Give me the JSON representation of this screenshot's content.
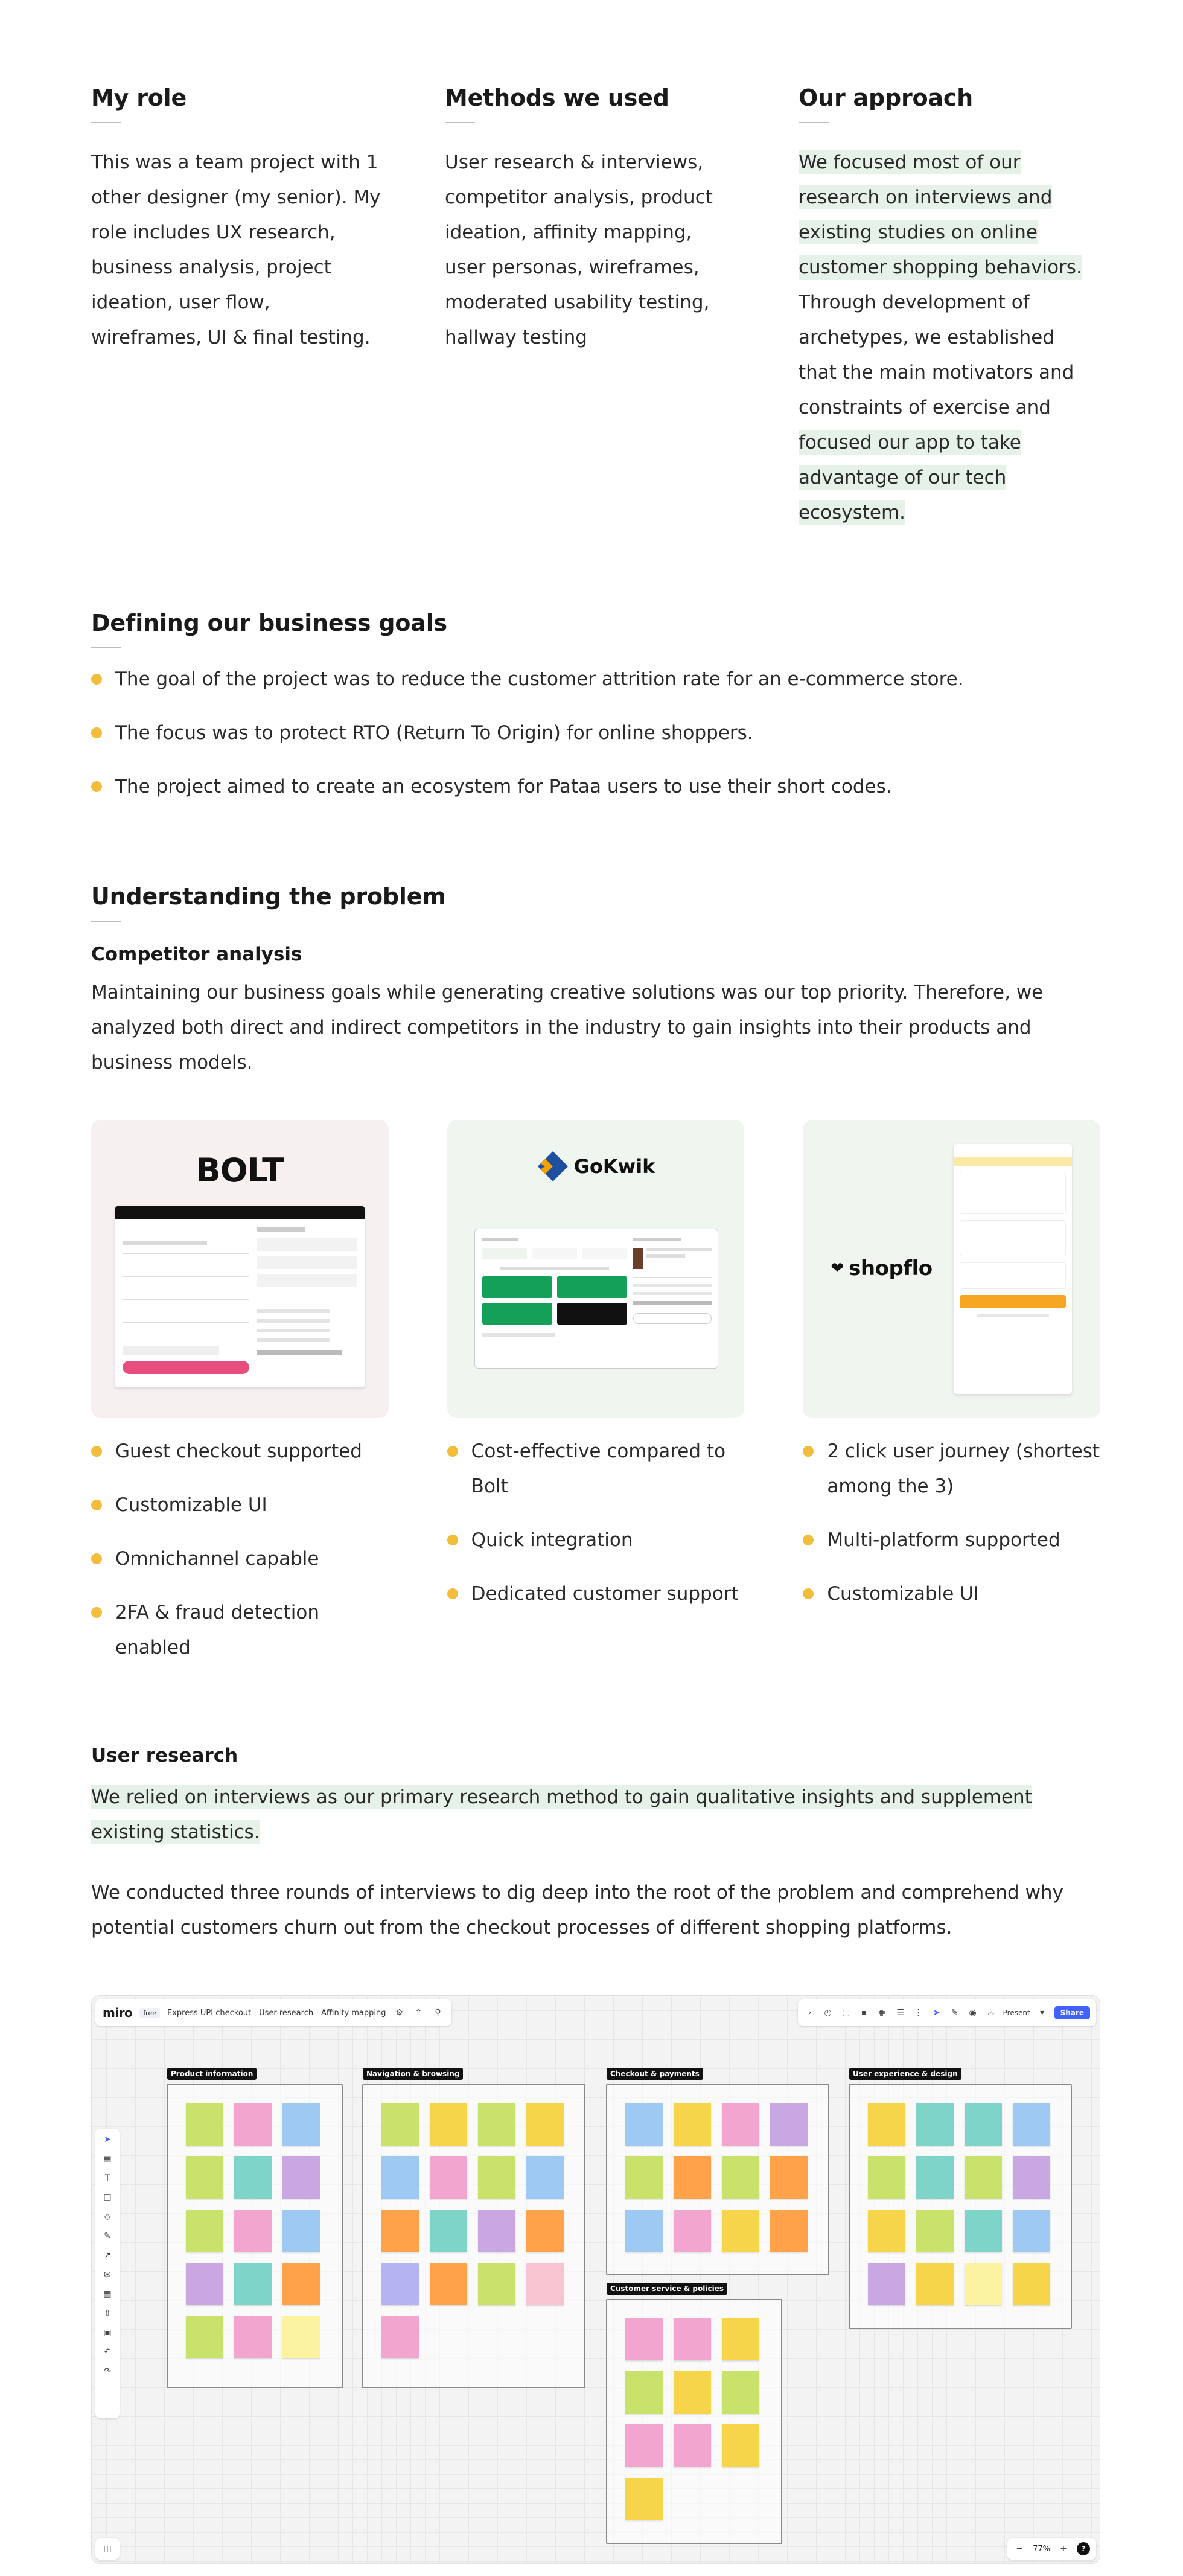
{
  "role": {
    "heading": "My role",
    "text": "This was a team project with 1 other designer (my senior). My role includes UX research, business analysis, project ideation, user flow, wireframes, UI & final testing."
  },
  "methods": {
    "heading": "Methods we used",
    "text": "User research & interviews, competitor analysis, product ideation, affinity mapping, user personas, wireframes, moderated usability testing, hallway testing"
  },
  "approach": {
    "heading": "Our approach",
    "highlight1": "We focused most of our research on interviews and existing studies on online customer shopping behaviors.",
    "middle": " Through development of archetypes, we established that the main motivators and constraints of exercise and ",
    "highlight2": "focused our app to take advantage of our tech ecosystem."
  },
  "goals": {
    "heading": "Defining our business goals",
    "items": [
      "The goal of the project was to reduce the customer attrition rate for an e-commerce store.",
      "The focus was to protect RTO (Return To Origin) for online shoppers.",
      "The project aimed to create an ecosystem for Pataa users to use their short codes."
    ]
  },
  "problem": {
    "heading": "Understanding the problem",
    "competitor_heading": "Competitor analysis",
    "competitor_text": "Maintaining our business goals while generating creative solutions was our top priority. Therefore, we analyzed both direct and indirect competitors in the industry to gain insights into their products and business models."
  },
  "competitors": [
    {
      "brand": "BOLT",
      "features": [
        "Guest checkout supported",
        "Customizable UI",
        "Omnichannel capable",
        "2FA & fraud detection enabled"
      ]
    },
    {
      "brand": "GoKwik",
      "features": [
        "Cost-effective compared to Bolt",
        "Quick integration",
        "Dedicated customer support"
      ]
    },
    {
      "brand": "shopflo",
      "features": [
        "2 click user journey (shortest among the 3)",
        "Multi-platform supported",
        "Customizable UI"
      ]
    }
  ],
  "research": {
    "heading": "User research",
    "highlight": "We relied on interviews as our primary research method to gain qualitative insights and supplement existing statistics.",
    "text": "We conducted three rounds of interviews to dig deep into the root of the problem and comprehend why potential customers churn out from the checkout processes of different shopping platforms."
  },
  "miro": {
    "logo": "miro",
    "plan": "free",
    "board_title": "Express UPI checkout - User research - Affinity mapping",
    "present": "Present",
    "share": "Share",
    "zoom": "77%",
    "frames": [
      {
        "title": "Product information"
      },
      {
        "title": "Navigation & browsing"
      },
      {
        "title": "Checkout & payments"
      },
      {
        "title": "Customer service & policies"
      },
      {
        "title": "User experience & design"
      }
    ],
    "sticky_colors": [
      "#c9e26b",
      "#f2a6cf",
      "#9ec9f2",
      "#f6d54a",
      "#7fd4c9",
      "#c8a7e3",
      "#ffa24a",
      "#fbf3a0",
      "#b6b3f2",
      "#f8c4d1"
    ]
  },
  "colors": {
    "accent_bullet": "#f2bd3a",
    "highlight": "#e6f1e8",
    "bolt_card": "#f6f0f1",
    "gokwik_card": "#eff5ef"
  }
}
